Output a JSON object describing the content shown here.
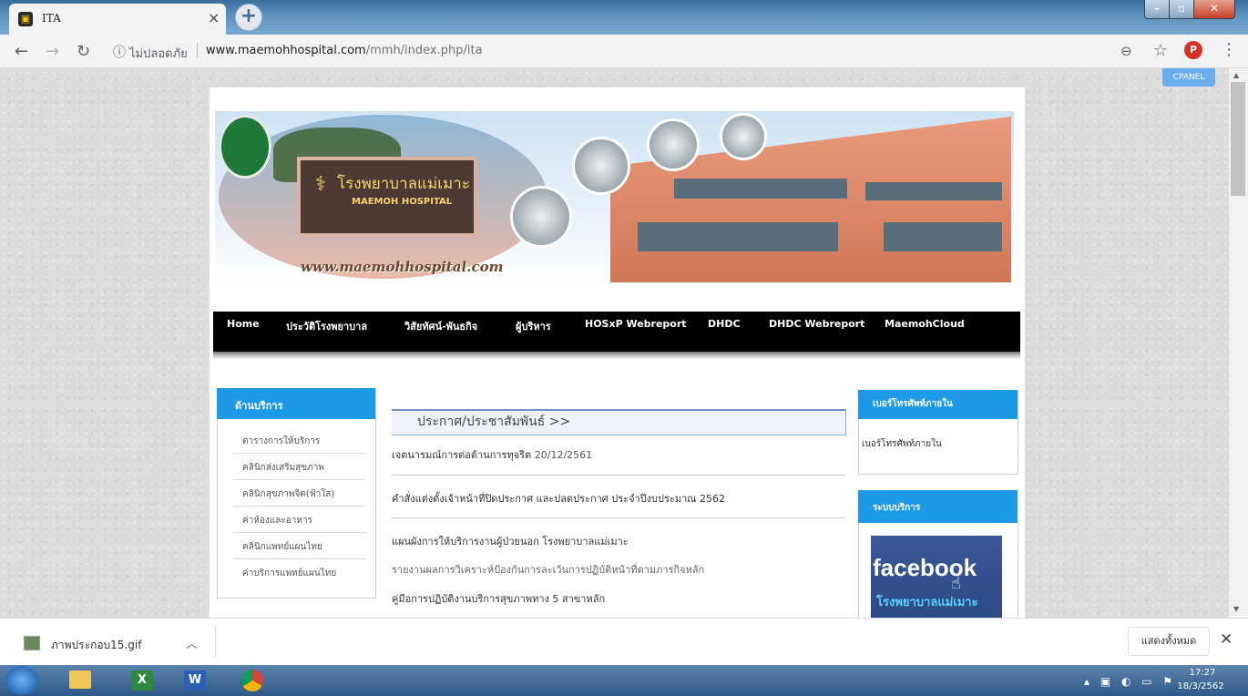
{
  "browser": {
    "tab_title": "ITA",
    "tab_favicon": "hospital-icon",
    "security_label": "ไม่ปลอดภัย",
    "url_host": "www.maemohhospital.com",
    "url_path": "/mmh/index.php/ita",
    "profile_initial": "P"
  },
  "site": {
    "cpanel_label": "CPANEL",
    "banner": {
      "name_th": "โรงพยาบาลแม่เมาะ",
      "name_en": "MAEMOH HOSPITAL",
      "url_text": "www.maemohhospital.com"
    },
    "nav": [
      "Home",
      "ประวัติโรงพยาบาล",
      "วิสัยทัศน์-พันธกิจ",
      "ผู้บริหาร",
      "HOSxP Webreport",
      "DHDC",
      "DHDC Webreport",
      "MaemohCloud"
    ],
    "left_sidebar": {
      "title": "ด้านบริการ",
      "items": [
        "ตารางการให้บริการ",
        "คลินิกส่งเสริมสุขภาพ",
        "คลินิกสุขภาพจิต(ฟ้าใส)",
        "ค่าห้องและอาหาร",
        "คลินิกแพทย์แผนไทย",
        "ค่าบริการแพทย์แผนไทย"
      ]
    },
    "main": {
      "heading": "ประกาศ/ประชาสัมพันธ์ >>",
      "news": [
        {
          "title": "เจตนารมณ์การต่อต้านการทุจริต",
          "date": "20/12/2561"
        },
        {
          "title": "คำสั่งแต่งตั้งเจ้าหน้าที่ปิดประกาศ และปลดประกาศ ประจำปีงบประมาณ 2562",
          "date": ""
        },
        {
          "title": "แผนผังการให้บริการงานผู้ป่วยนอก โรงพยาบาลแม่เมาะ",
          "date": ""
        },
        {
          "title": "รายงานผลการวิเคราะห์ป้องกันการละเว้นการปฏิบัติหน้าที่ตามภารกิจหลัก",
          "date": ""
        },
        {
          "title": "คู่มือการปฏิบัติงานบริการสุขภาพทาง 5 สาขาหลัก",
          "date": ""
        }
      ]
    },
    "right_sidebar": {
      "phone_title": "เบอร์โทรศัพท์ภายใน",
      "phone_link": "เบอร์โทรศัพท์ภายใน",
      "services_title": "ระบบบริการ",
      "facebook_label": "facebook",
      "facebook_sub": "โรงพยาบาลแม่เมาะ"
    }
  },
  "download_bar": {
    "file_name": "ภาพประกอบ15.gif",
    "show_all": "แสดงทั้งหมด"
  },
  "taskbar": {
    "time": "17:27",
    "date": "18/3/2562"
  }
}
